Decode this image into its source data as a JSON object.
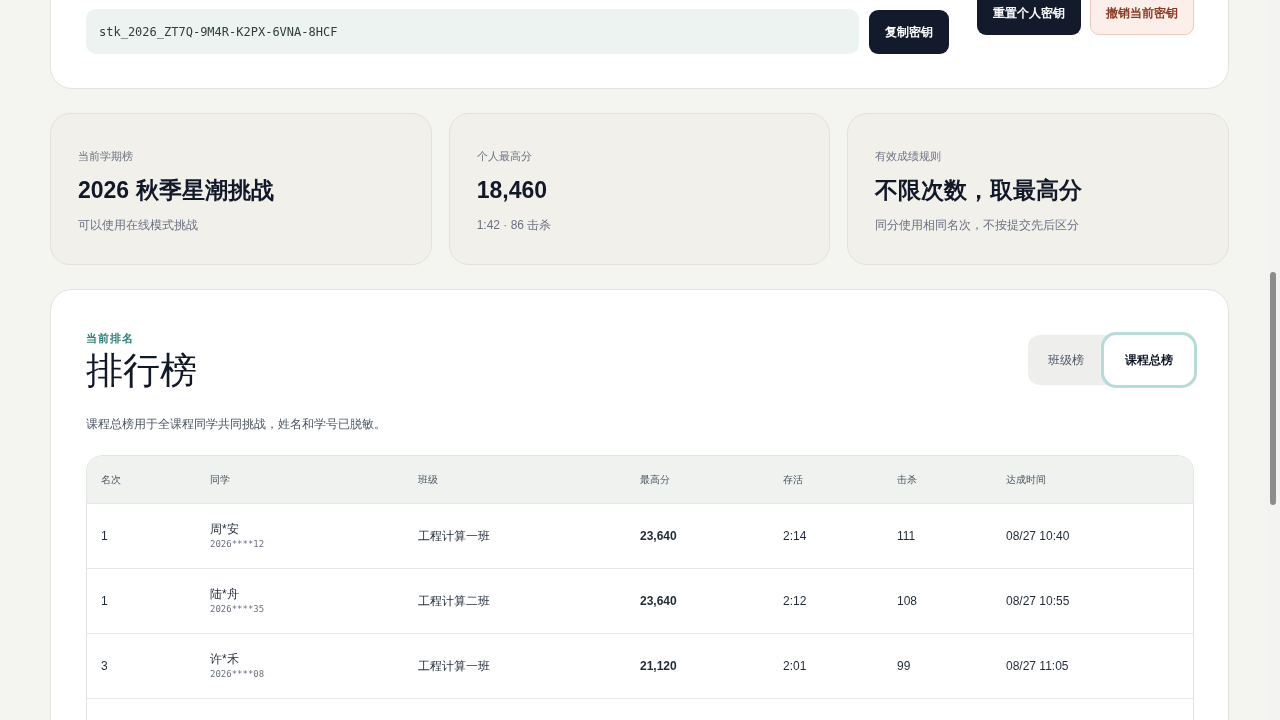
{
  "key_panel": {
    "key_value": "stk_2026_ZT7Q-9M4R-K2PX-6VNA-8HCF",
    "copy_button": "复制密钥",
    "reset_button": "重置个人密钥",
    "revoke_button": "撤销当前密钥"
  },
  "stats": [
    {
      "label": "当前学期榜",
      "value": "2026 秋季星潮挑战",
      "note": "可以使用在线模式挑战"
    },
    {
      "label": "个人最高分",
      "value": "18,460",
      "note": "1:42 · 86 击杀"
    },
    {
      "label": "有效成绩规则",
      "value": "不限次数，取最高分",
      "note": "同分使用相同名次，不按提交先后区分"
    }
  ],
  "leaderboard": {
    "eyebrow": "当前排名",
    "title": "排行榜",
    "description": "课程总榜用于全课程同学共同挑战，姓名和学号已脱敏。",
    "tabs": [
      {
        "label": "班级榜",
        "selected": false
      },
      {
        "label": "课程总榜",
        "selected": true
      }
    ],
    "table": {
      "columns": [
        "名次",
        "同学",
        "班级",
        "最高分",
        "存活",
        "击杀",
        "达成时间"
      ],
      "rows": [
        {
          "rank": "1",
          "name": "周*安",
          "student_id": "2026****12",
          "class": "工程计算一班",
          "score": "23,640",
          "survival": "2:14",
          "kills": "111",
          "time": "08/27 10:40"
        },
        {
          "rank": "1",
          "name": "陆*舟",
          "student_id": "2026****35",
          "class": "工程计算二班",
          "score": "23,640",
          "survival": "2:12",
          "kills": "108",
          "time": "08/27 10:55"
        },
        {
          "rank": "3",
          "name": "许*禾",
          "student_id": "2026****08",
          "class": "工程计算一班",
          "score": "21,120",
          "survival": "2:01",
          "kills": "99",
          "time": "08/27 11:05"
        }
      ]
    }
  }
}
